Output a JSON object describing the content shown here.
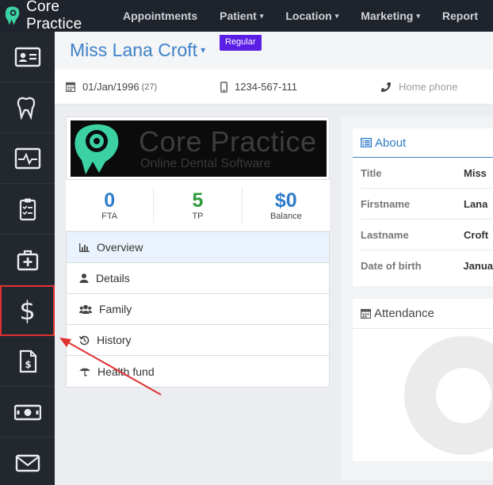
{
  "brand": {
    "name": "Core Practice",
    "accent": "#3bd1a3"
  },
  "nav": [
    {
      "label": "Appointments",
      "dropdown": false
    },
    {
      "label": "Patient",
      "dropdown": true
    },
    {
      "label": "Location",
      "dropdown": true
    },
    {
      "label": "Marketing",
      "dropdown": true
    },
    {
      "label": "Report",
      "dropdown": false
    }
  ],
  "sidebar": {
    "items": [
      {
        "icon": "id-card-icon"
      },
      {
        "icon": "tooth-icon"
      },
      {
        "icon": "heartbeat-monitor-icon"
      },
      {
        "icon": "clipboard-checklist-icon"
      },
      {
        "icon": "first-aid-kit-icon"
      },
      {
        "icon": "dollar-icon",
        "glyph": "$",
        "highlighted": true
      },
      {
        "icon": "invoice-icon"
      },
      {
        "icon": "cash-icon"
      },
      {
        "icon": "envelope-icon"
      }
    ]
  },
  "patient": {
    "name": "Miss Lana Croft",
    "caret": "▾",
    "badge": "Regular",
    "dob": "01/Jan/1996",
    "age": "(27)",
    "mobile": "1234-567-111",
    "home_phone": "Home phone"
  },
  "logo_card": {
    "big": "Core Practice",
    "small": "Online Dental Software"
  },
  "stats": [
    {
      "value": "0",
      "label": "FTA",
      "color": "#2f7cc9"
    },
    {
      "value": "5",
      "label": "TP",
      "color": "#2e9a3e"
    },
    {
      "value": "$0",
      "label": "Balance",
      "color": "#2f7cc9"
    }
  ],
  "tabs": [
    {
      "label": "Overview",
      "icon": "bar-chart-icon",
      "active": true
    },
    {
      "label": "Details",
      "icon": "user-icon",
      "active": false
    },
    {
      "label": "Family",
      "icon": "users-icon",
      "active": false
    },
    {
      "label": "History",
      "icon": "history-icon",
      "active": false
    },
    {
      "label": "Health fund",
      "icon": "umbrella-icon",
      "active": false
    }
  ],
  "about": {
    "heading": "About",
    "rows": [
      {
        "key": "Title",
        "value": "Miss"
      },
      {
        "key": "Firstname",
        "value": "Lana"
      },
      {
        "key": "Lastname",
        "value": "Croft"
      },
      {
        "key": "Date of birth",
        "value": "Janua"
      }
    ]
  },
  "attendance": {
    "heading": "Attendance"
  },
  "annotation": {
    "arrow_color": "#e03030"
  }
}
